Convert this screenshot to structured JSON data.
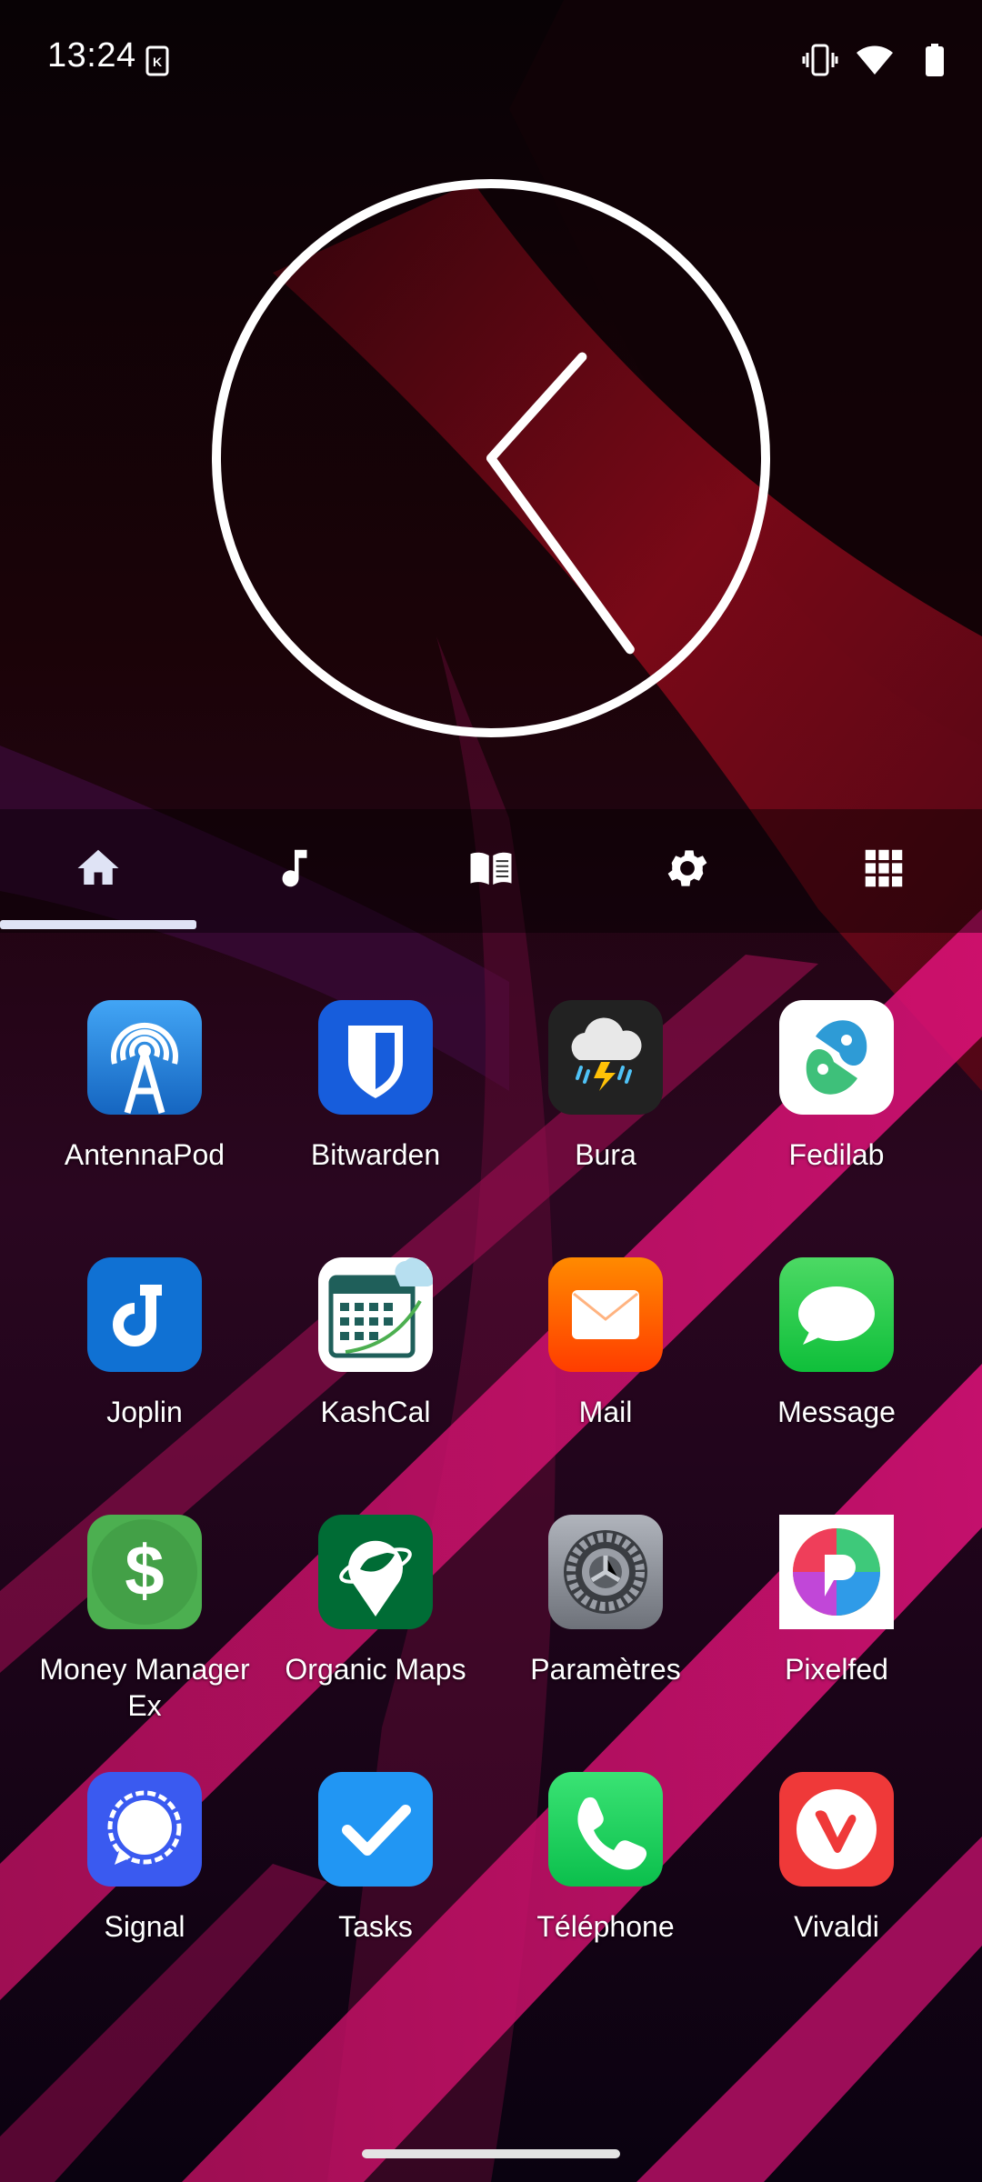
{
  "status_bar": {
    "time": "13:24",
    "icons": [
      "notification-card-icon",
      "vibrate-icon",
      "wifi-icon",
      "battery-icon"
    ]
  },
  "clock_widget": {
    "hour": 1,
    "minute": 24
  },
  "dock_tabs": [
    {
      "name": "home",
      "icon": "home-icon",
      "selected": true
    },
    {
      "name": "music",
      "icon": "music-note-icon",
      "selected": false
    },
    {
      "name": "books",
      "icon": "book-icon",
      "selected": false
    },
    {
      "name": "settings",
      "icon": "gear-icon",
      "selected": false
    },
    {
      "name": "apps",
      "icon": "grid-icon",
      "selected": false
    }
  ],
  "apps": [
    {
      "label": "AntennaPod",
      "icon": "antennapod-icon",
      "color": "#1e88e5"
    },
    {
      "label": "Bitwarden",
      "icon": "bitwarden-icon",
      "color": "#175ddc"
    },
    {
      "label": "Bura",
      "icon": "bura-weather-icon",
      "color": "#222222"
    },
    {
      "label": "Fedilab",
      "icon": "fedilab-icon",
      "color": "#ffffff"
    },
    {
      "label": "Joplin",
      "icon": "joplin-icon",
      "color": "#1071d3"
    },
    {
      "label": "KashCal",
      "icon": "kashcal-calendar-icon",
      "color": "#ffffff"
    },
    {
      "label": "Mail",
      "icon": "mail-icon",
      "color": "#ff6d00"
    },
    {
      "label": "Message",
      "icon": "message-icon",
      "color": "#2ec84a"
    },
    {
      "label": "Money Manager Ex",
      "icon": "money-manager-icon",
      "color": "#4caf50"
    },
    {
      "label": "Organic Maps",
      "icon": "organic-maps-icon",
      "color": "#006c35"
    },
    {
      "label": "Paramètres",
      "icon": "settings-gear-icon",
      "color": "#8e8e93"
    },
    {
      "label": "Pixelfed",
      "icon": "pixelfed-icon",
      "color": "#ffffff"
    },
    {
      "label": "Signal",
      "icon": "signal-icon",
      "color": "#3a76f0"
    },
    {
      "label": "Tasks",
      "icon": "tasks-check-icon",
      "color": "#2196f3"
    },
    {
      "label": "Téléphone",
      "icon": "phone-icon",
      "color": "#1ec957"
    },
    {
      "label": "Vivaldi",
      "icon": "vivaldi-icon",
      "color": "#ef3939"
    }
  ]
}
